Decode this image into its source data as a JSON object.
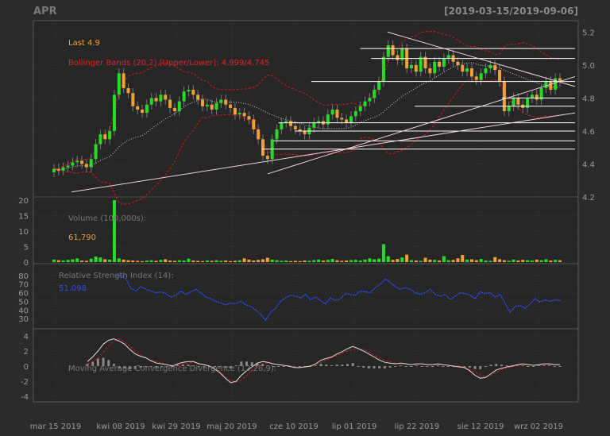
{
  "header": {
    "symbol": "APR",
    "date_range": "[2019-03-15/2019-09-06]"
  },
  "legend": {
    "last": "Last 4.9",
    "bollinger": "Bollinger Bands (20,2) [Upper/Lower]: 4.999/4.745",
    "volume": "Volume (100,000s):",
    "volume_value": "61,790",
    "rsi": "Relative Strength Index (14):",
    "rsi_value": "51.098",
    "macd": "Moving Average Convergence Divergence (12,26,9):"
  },
  "colors": {
    "up": "#22dd22",
    "down": "#f0a030",
    "bollinger": "#d01818",
    "rsi": "#2a4fff",
    "macd": "#dddddd",
    "signal": "#d01818",
    "histogram": "#888888",
    "grid": "#3a3a3a",
    "axis_text": "#999999"
  },
  "chart_data": {
    "type": "candlestick",
    "x_tick_labels": [
      "mar 15 2019",
      "kwi 08 2019",
      "kwi 29 2019",
      "maj 20 2019",
      "cze 10 2019",
      "lip 01 2019",
      "lip 22 2019",
      "sie 12 2019",
      "wrz 02 2019"
    ],
    "price_axis": {
      "ticks": [
        4.2,
        4.4,
        4.6,
        4.8,
        5.0,
        5.2
      ],
      "range": [
        4.2,
        5.25
      ]
    },
    "volume_axis": {
      "ticks": [
        0,
        5,
        10,
        15,
        20
      ],
      "range": [
        0,
        20
      ]
    },
    "rsi_axis": {
      "ticks": [
        30,
        40,
        50,
        60,
        70,
        80
      ],
      "range": [
        20,
        90
      ]
    },
    "macd_axis": {
      "ticks": [
        -4,
        -2,
        0,
        2,
        4
      ],
      "range": [
        -4.5,
        4.5
      ]
    },
    "close": [
      4.37,
      4.36,
      4.38,
      4.39,
      4.41,
      4.42,
      4.4,
      4.38,
      4.43,
      4.52,
      4.58,
      4.55,
      4.6,
      4.82,
      4.95,
      4.86,
      4.83,
      4.75,
      4.73,
      4.71,
      4.76,
      4.8,
      4.78,
      4.82,
      4.79,
      4.74,
      4.72,
      4.78,
      4.84,
      4.85,
      4.82,
      4.79,
      4.75,
      4.76,
      4.73,
      4.77,
      4.79,
      4.76,
      4.74,
      4.7,
      4.71,
      4.69,
      4.67,
      4.61,
      4.55,
      4.45,
      4.43,
      4.55,
      4.61,
      4.65,
      4.66,
      4.63,
      4.61,
      4.6,
      4.58,
      4.62,
      4.65,
      4.66,
      4.64,
      4.7,
      4.73,
      4.68,
      4.67,
      4.65,
      4.69,
      4.72,
      4.75,
      4.78,
      4.8,
      4.85,
      4.9,
      5.05,
      5.12,
      5.06,
      5.03,
      5.1,
      4.98,
      5.0,
      4.96,
      5.05,
      4.98,
      4.95,
      5.02,
      4.99,
      5.04,
      5.06,
      5.02,
      5.0,
      4.96,
      4.98,
      4.93,
      4.91,
      4.95,
      4.98,
      5.0,
      4.97,
      4.9,
      4.72,
      4.75,
      4.8,
      4.76,
      4.74,
      4.8,
      4.82,
      4.79,
      4.86,
      4.9,
      4.85,
      4.92,
      4.9
    ],
    "volume": [
      0.8,
      0.6,
      0.5,
      0.7,
      0.9,
      1.2,
      0.5,
      0.4,
      1.1,
      1.8,
      1.5,
      0.9,
      0.8,
      20.0,
      1.2,
      0.8,
      0.6,
      0.5,
      0.4,
      0.3,
      0.5,
      0.6,
      0.4,
      0.7,
      0.9,
      0.5,
      0.4,
      0.6,
      0.5,
      1.1,
      0.5,
      0.4,
      0.3,
      0.5,
      0.4,
      0.6,
      0.4,
      0.5,
      0.3,
      0.4,
      0.6,
      1.2,
      0.8,
      0.5,
      0.7,
      0.9,
      1.4,
      0.8,
      0.6,
      0.4,
      0.5,
      0.3,
      0.4,
      0.3,
      0.5,
      0.4,
      0.6,
      0.8,
      0.5,
      0.7,
      1.0,
      0.6,
      0.4,
      0.5,
      0.6,
      0.7,
      0.5,
      0.8,
      1.2,
      0.9,
      1.1,
      5.8,
      1.9,
      0.7,
      1.0,
      1.5,
      2.4,
      0.6,
      0.5,
      0.4,
      1.4,
      0.8,
      0.7,
      0.5,
      1.9,
      0.6,
      0.7,
      1.2,
      2.3,
      0.8,
      0.9,
      0.6,
      1.0,
      0.5,
      0.4,
      1.6,
      0.9,
      0.6,
      0.4,
      0.8,
      0.5,
      0.7,
      0.6,
      0.5,
      0.8,
      0.6,
      0.9,
      0.5,
      0.7,
      0.6
    ],
    "rsi": [
      80,
      80,
      76,
      65,
      62,
      67,
      64,
      62,
      60,
      61,
      59,
      55,
      57,
      62,
      58,
      61,
      64,
      60,
      55,
      53,
      50,
      48,
      46,
      48,
      47,
      50,
      46,
      44,
      40,
      35,
      28,
      37,
      42,
      50,
      54,
      57,
      56,
      54,
      58,
      52,
      55,
      51,
      47,
      54,
      51,
      53,
      59,
      58,
      57,
      62,
      61,
      60,
      66,
      70,
      76,
      72,
      67,
      64,
      66,
      64,
      60,
      58,
      60,
      64,
      58,
      56,
      58,
      52,
      56,
      60,
      59,
      57,
      53,
      61,
      59,
      60,
      55,
      58,
      48,
      37,
      44,
      45,
      42,
      47,
      53,
      49,
      52,
      50,
      52,
      51
    ],
    "macd": [
      0.6,
      1.2,
      2.0,
      2.9,
      3.4,
      3.6,
      3.3,
      2.9,
      2.2,
      1.6,
      1.3,
      1.1,
      0.7,
      0.4,
      0.3,
      0.2,
      0.0,
      0.3,
      0.5,
      0.6,
      0.6,
      0.3,
      0.2,
      0.0,
      -0.4,
      -0.9,
      -1.6,
      -2.2,
      -2.0,
      -1.2,
      -0.6,
      -0.1,
      0.4,
      0.6,
      0.5,
      0.3,
      0.2,
      0.1,
      0.0,
      -0.2,
      -0.2,
      -0.1,
      0.0,
      0.3,
      0.8,
      1.0,
      1.2,
      1.6,
      1.9,
      2.3,
      2.6,
      2.3,
      2.0,
      1.6,
      1.2,
      0.8,
      0.5,
      0.4,
      0.3,
      0.4,
      0.3,
      0.2,
      0.3,
      0.3,
      0.2,
      0.2,
      0.3,
      0.2,
      0.1,
      0.0,
      -0.1,
      -0.2,
      -0.6,
      -1.2,
      -1.6,
      -1.5,
      -1.0,
      -0.5,
      -0.3,
      -0.1,
      0.0,
      0.2,
      0.3,
      0.2,
      0.1,
      0.2,
      0.3,
      0.3,
      0.2,
      0.2
    ],
    "signal": [
      0.3,
      0.6,
      1.0,
      1.8,
      2.6,
      3.3,
      3.6,
      3.2,
      2.6,
      2.0,
      1.5,
      1.1,
      0.8,
      0.6,
      0.4,
      0.2,
      0.1,
      0.1,
      0.3,
      0.4,
      0.5,
      0.4,
      0.2,
      0.0,
      -0.3,
      -0.8,
      -1.4,
      -1.9,
      -2.1,
      -1.8,
      -1.2,
      -0.6,
      0.0,
      0.3,
      0.4,
      0.3,
      0.2,
      0.1,
      0.0,
      -0.1,
      -0.2,
      -0.1,
      0.0,
      0.2,
      0.5,
      0.8,
      1.1,
      1.4,
      1.7,
      2.0,
      2.2,
      2.3,
      2.2,
      1.9,
      1.5,
      1.1,
      0.8,
      0.6,
      0.4,
      0.3,
      0.3,
      0.2,
      0.2,
      0.3,
      0.2,
      0.2,
      0.2,
      0.2,
      0.1,
      0.0,
      0.0,
      -0.1,
      -0.4,
      -0.8,
      -1.2,
      -1.4,
      -1.2,
      -0.8,
      -0.5,
      -0.2,
      -0.1,
      0.1,
      0.2,
      0.2,
      0.1,
      0.1,
      0.2,
      0.2,
      0.2,
      0.2
    ],
    "horizontal_levels": [
      {
        "y": 5.1,
        "from": 0.6,
        "to": 1.0
      },
      {
        "y": 5.04,
        "from": 0.62,
        "to": 1.0
      },
      {
        "y": 4.9,
        "from": 0.51,
        "to": 1.0
      },
      {
        "y": 4.8,
        "from": 0.86,
        "to": 1.0
      },
      {
        "y": 4.75,
        "from": 0.7,
        "to": 1.0
      },
      {
        "y": 4.65,
        "from": 0.45,
        "to": 1.0
      },
      {
        "y": 4.6,
        "from": 0.48,
        "to": 1.0
      },
      {
        "y": 4.54,
        "from": 0.44,
        "to": 1.0
      },
      {
        "y": 4.49,
        "from": 0.42,
        "to": 1.0
      }
    ],
    "trendlines": [
      {
        "x1": 0.07,
        "y1": 4.23,
        "x2": 1.0,
        "y2": 4.71
      },
      {
        "x1": 0.43,
        "y1": 4.34,
        "x2": 1.0,
        "y2": 4.93
      },
      {
        "x1": 0.65,
        "y1": 5.2,
        "x2": 1.0,
        "y2": 4.87
      }
    ]
  }
}
